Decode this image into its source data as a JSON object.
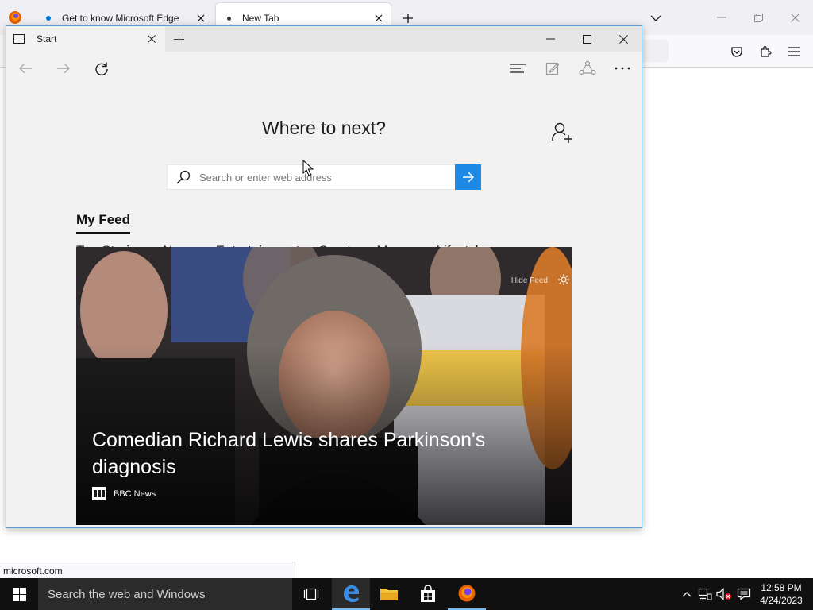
{
  "firefox": {
    "tabs": [
      {
        "title": "Get to know Microsoft Edge",
        "favicon_color": "#0078d4"
      },
      {
        "title": "New Tab",
        "favicon_color": "#3b3b3b"
      }
    ],
    "status_text": "microsoft.com",
    "icons": {
      "logo": "firefox-logo-icon",
      "new_tab": "plus-icon",
      "tab_list": "chevron-down-icon",
      "pocket": "pocket-icon",
      "extensions": "extensions-icon",
      "menu": "hamburger-menu-icon"
    }
  },
  "edge": {
    "tab_title": "Start",
    "heading": "Where to next?",
    "search": {
      "placeholder": "Search or enter web address",
      "value": ""
    },
    "feed": {
      "title": "My Feed",
      "categories": [
        "Top Stories",
        "News",
        "Entertainment",
        "Sports",
        "Money",
        "Lifestyl"
      ],
      "hide_feed": "Hide Feed",
      "hero": {
        "headline": "Comedian Richard Lewis shares Parkinson's diagnosis",
        "source": "BBC News"
      }
    },
    "icons": {
      "back": "arrow-left-icon",
      "forward": "arrow-right-icon",
      "refresh": "refresh-icon",
      "hub": "hub-icon",
      "web_note": "web-note-icon",
      "share": "share-icon",
      "more": "more-icon",
      "profile": "add-person-icon",
      "go": "arrow-right-icon",
      "settings": "gear-icon"
    },
    "accent_color": "#1e88e5"
  },
  "taskbar": {
    "search_text": "Search the web and Windows",
    "time": "12:58 PM",
    "date": "4/24/2023",
    "pinned": [
      "task-view",
      "edge",
      "file-explorer",
      "store",
      "firefox"
    ]
  }
}
